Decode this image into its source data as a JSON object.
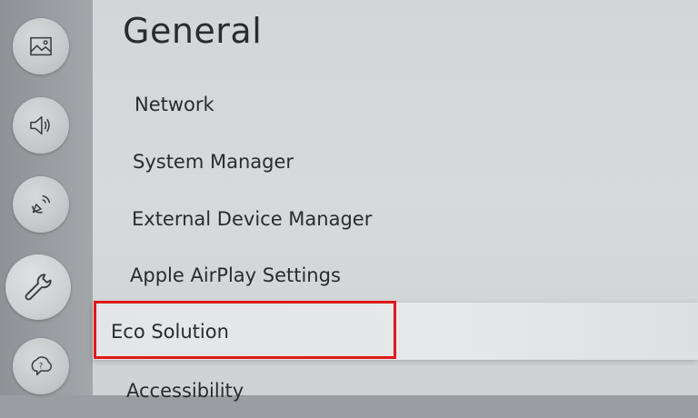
{
  "header": {
    "title": "General"
  },
  "sidebar": {
    "items": [
      {
        "icon": "picture-icon"
      },
      {
        "icon": "sound-icon"
      },
      {
        "icon": "broadcasting-icon"
      },
      {
        "icon": "wrench-icon",
        "active": true
      },
      {
        "icon": "support-icon"
      }
    ]
  },
  "menu": {
    "items": [
      {
        "label": "Network"
      },
      {
        "label": "System Manager"
      },
      {
        "label": "External Device Manager"
      },
      {
        "label": "Apple AirPlay Settings"
      },
      {
        "label": "Eco Solution",
        "focused": true
      },
      {
        "label": "Accessibility"
      }
    ]
  },
  "colors": {
    "highlight": "#e01818",
    "focus_bg": "#e6e8eb"
  }
}
